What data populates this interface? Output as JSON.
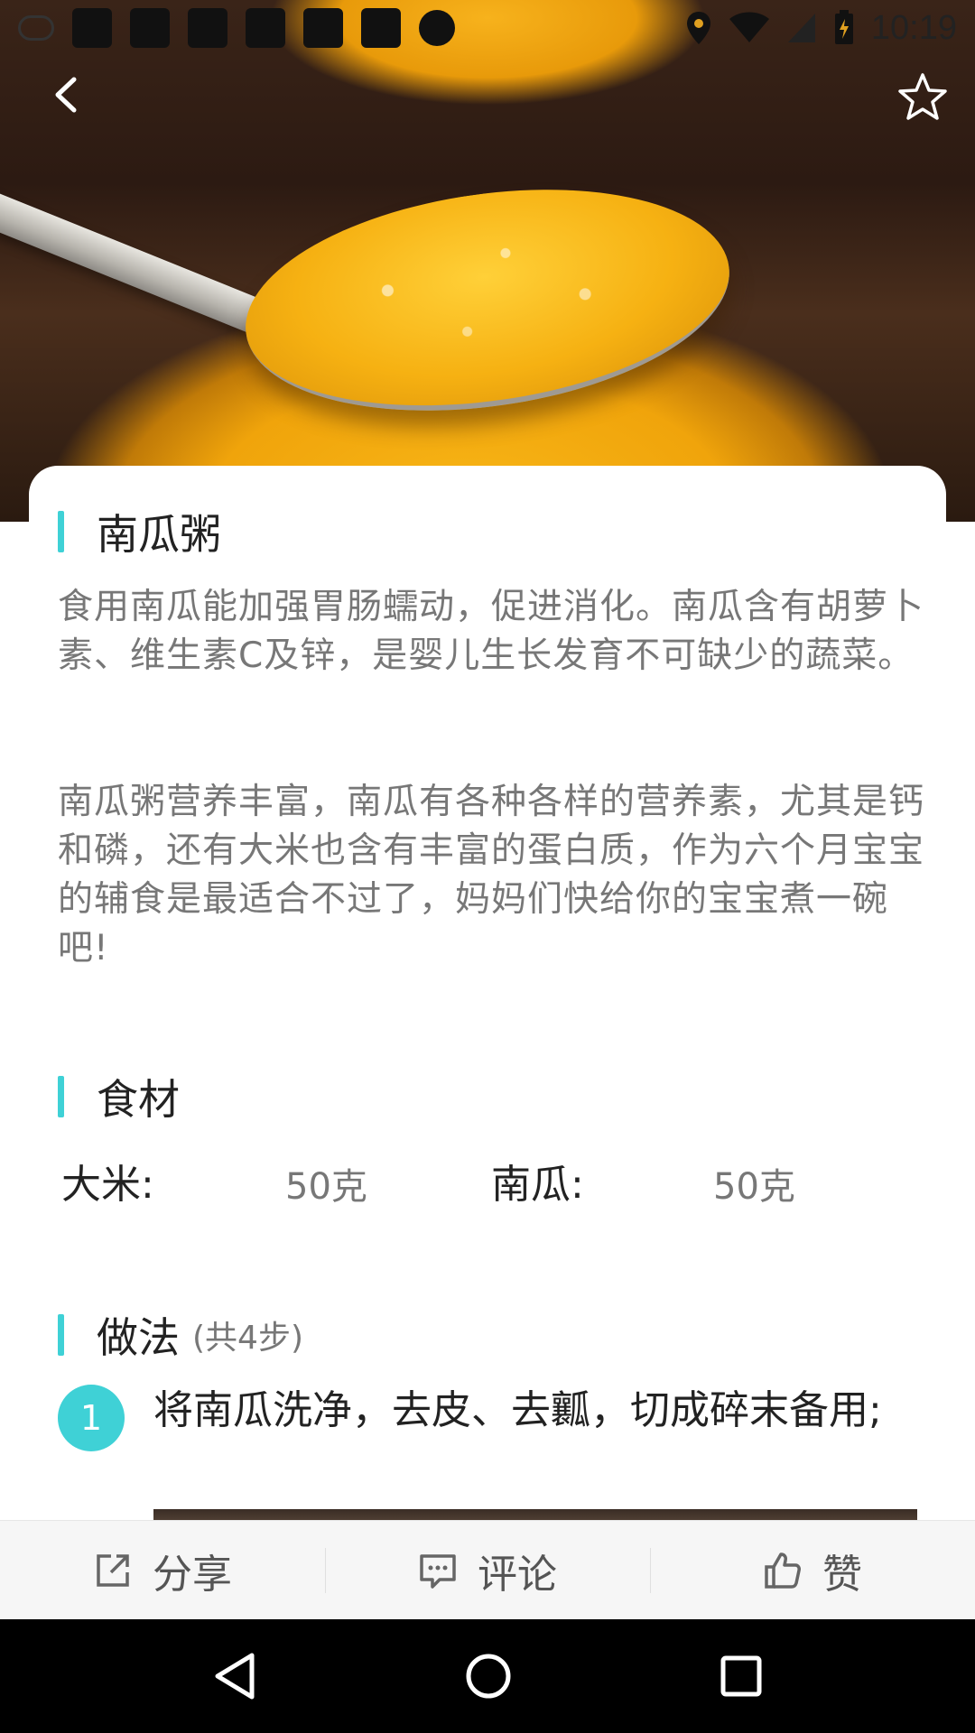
{
  "status_bar": {
    "time": "10:19"
  },
  "recipe": {
    "title": "南瓜粥",
    "description_1": "食用南瓜能加强胃肠蠕动，促进消化。南瓜含有胡萝卜素、维生素C及锌，是婴儿生长发育不可缺少的蔬菜。",
    "description_2": "南瓜粥营养丰富，南瓜有各种各样的营养素，尤其是钙和磷，还有大米也含有丰富的蛋白质，作为六个月宝宝的辅食是最适合不过了，妈妈们快给你的宝宝煮一碗吧!"
  },
  "ingredients": {
    "title": "食材",
    "items": [
      {
        "name": "大米:",
        "amount": "50克"
      },
      {
        "name": "南瓜:",
        "amount": "50克"
      }
    ]
  },
  "method": {
    "title": "做法",
    "count_label": "(共4步)",
    "steps": [
      {
        "number": "1",
        "text": "将南瓜洗净，去皮、去瓤，切成碎末备用;"
      }
    ]
  },
  "actions": {
    "share": "分享",
    "comment": "评论",
    "like": "赞"
  },
  "colors": {
    "accent": "#3fd1d6",
    "text_primary": "#222222",
    "text_secondary": "#777777"
  }
}
